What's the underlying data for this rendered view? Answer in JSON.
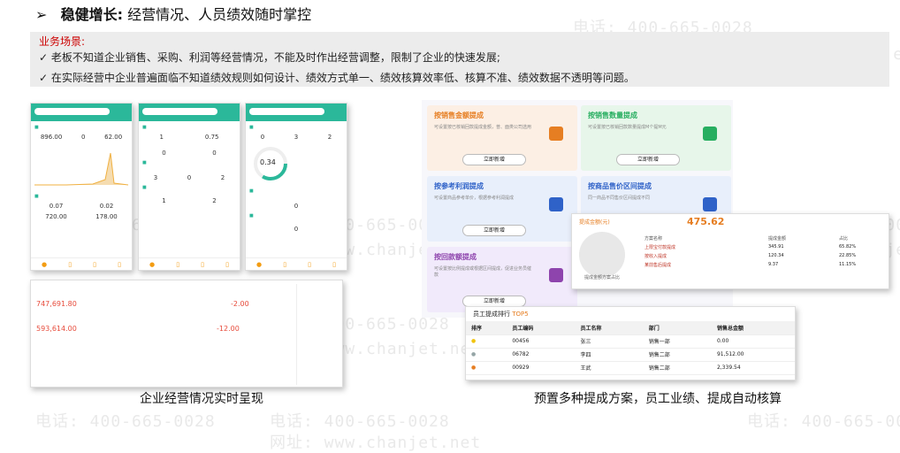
{
  "title": {
    "bullet": "➢",
    "bold": "稳健增长:",
    "text": "经营情况、人员绩效随时掌控"
  },
  "scenario": {
    "label": "业务场景:",
    "lines": [
      "✓ 老板不知道企业销售、采购、利润等经营情况，不能及时作出经营调整，限制了企业的快速发展;",
      "✓ 在实际经营中企业普遍面临不知道绩效规则如何设计、绩效方式单一、绩效核算效率低、核算不准、绩效数据不透明等问题。"
    ]
  },
  "watermark": {
    "phone": "电话: 400-665-0028",
    "site": "网址: www.chanjet.net"
  },
  "phones": {
    "p1": {
      "n1": "896.00",
      "n2": "0",
      "n3": "62.00",
      "n4": "0.07",
      "n5": "0.02",
      "n6": "720.00",
      "n7": "178.00"
    },
    "p2": {
      "n1": "1",
      "n2": "0.75",
      "n3": "0",
      "n4": "0",
      "n5": "3",
      "n6": "0",
      "n7": "2",
      "n8": "1",
      "n9": "2"
    },
    "p3": {
      "n1": "0",
      "n2": "3",
      "n3": "2",
      "gauge": "0.34",
      "n4": "0",
      "n5": "0"
    }
  },
  "dashboard": {
    "v1": "747,691.80",
    "v2": "-2.00",
    "v3": "593,614.00",
    "v4": "-12.00"
  },
  "cards": [
    {
      "title": "按销售金额提成",
      "desc": "可设置按已核销回款提成金额，普、面类公司选用",
      "btn": "立即新增",
      "bg": "#fcefe4",
      "color": "#e67e22"
    },
    {
      "title": "按销售数量提成",
      "desc": "可设置按已核销回款数量提成M个提M元",
      "btn": "立即新增",
      "bg": "#e7f6ea",
      "color": "#27ae60"
    },
    {
      "title": "按参考利润提成",
      "desc": "可设置商品参考单价，根据参考利润提成",
      "btn": "立即新增",
      "bg": "#e8effb",
      "color": "#2f62c8"
    },
    {
      "title": "按商品售价区间提成",
      "desc": "同一商品不同售价区间提成不同",
      "btn": "立即新增",
      "bg": "#e8effb",
      "color": "#2f62c8"
    },
    {
      "title": "按回款额提成",
      "desc": "可设置按比例提成或根据区间提成，促进业务员催款",
      "btn": "立即新增",
      "bg": "#f1eafb",
      "color": "#8e44ad"
    }
  ],
  "popup": {
    "label": "提成金额(元)",
    "total": "475.62",
    "headers": [
      "方案名称",
      "提成金额",
      "占比"
    ],
    "rows": [
      {
        "name": "上限宝付款提成",
        "amount": "345.91",
        "pct": "65.82%"
      },
      {
        "name": "按收入提成",
        "amount": "120.34",
        "pct": "22.85%"
      },
      {
        "name": "某前售后提成",
        "amount": "9.37",
        "pct": "11.15%"
      }
    ],
    "footer": "提成金额方案占比"
  },
  "rank": {
    "title": "员工提成排行",
    "top": "TOP5",
    "headers": [
      "排序",
      "员工编码",
      "员工名称",
      "部门",
      "销售总金额"
    ],
    "rows": [
      {
        "code": "00456",
        "name": "张三",
        "dept": "销售一部",
        "amount": "0.00"
      },
      {
        "code": "06782",
        "name": "李四",
        "dept": "销售二部",
        "amount": "91,512.00"
      },
      {
        "code": "00929",
        "name": "王武",
        "dept": "销售二部",
        "amount": "2,339.54"
      }
    ]
  },
  "captions": {
    "left": "企业经营情况实时呈现",
    "right": "预置多种提成方案，员工业绩、提成自动核算"
  }
}
